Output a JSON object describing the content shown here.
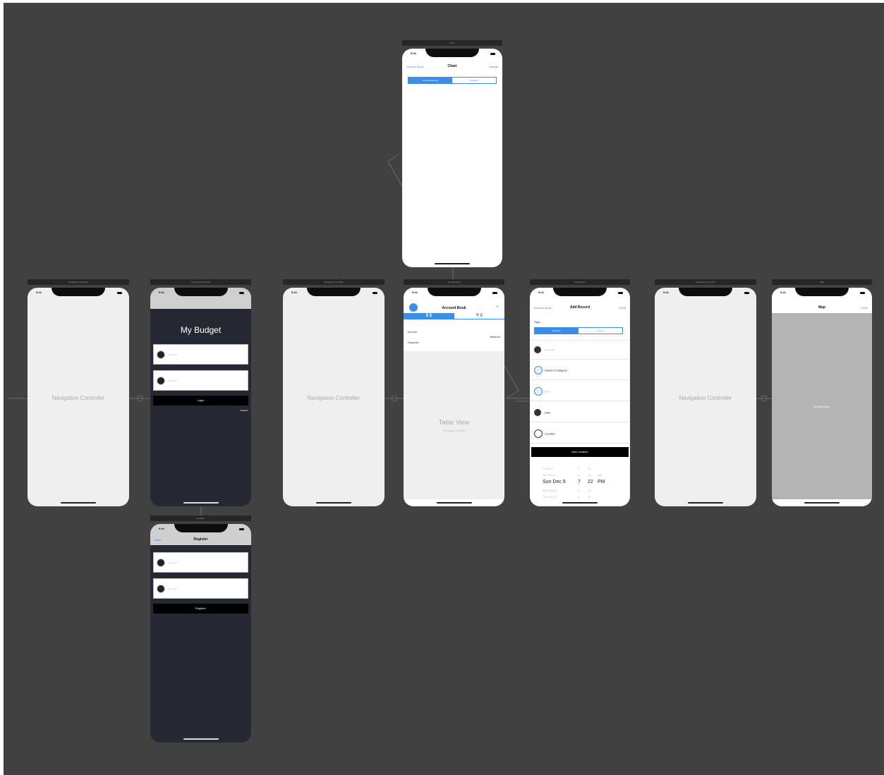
{
  "scene_headers": {
    "chart": "Chart",
    "nav1": "Navigation Controller",
    "login": "Login View Controller",
    "nav2": "Navigation Controller",
    "accountbook": "Account Book",
    "addrecord": "Add Record",
    "nav3": "Navigation Controller",
    "map": "Map",
    "register": "Register"
  },
  "status_time": "9:41",
  "navigation_controller": {
    "label": "Navigation Controller"
  },
  "chart_screen": {
    "back_label": "Account Book",
    "title": "Chart",
    "right_label": "change",
    "segments": [
      "Income/Expense",
      "Category"
    ]
  },
  "login": {
    "title": "My Budget",
    "username_placeholder": "Username",
    "password_placeholder": "Password",
    "login_label": "Login",
    "register_label": "Register"
  },
  "register_screen": {
    "back_label": "Back",
    "title": "Register",
    "username_placeholder": "Username",
    "password_placeholder": "Password",
    "register_label": "Register"
  },
  "account_book": {
    "title": "Account Book",
    "add_icon": "+",
    "tabs": [
      "$ $",
      "₹ $"
    ],
    "income_label": "Income",
    "expense_label": "Expense",
    "balance_label": "Balance",
    "table_title": "Table View",
    "table_subtitle": "Prototype Content"
  },
  "add_record": {
    "back_label": "Account Book",
    "title": "Add Record",
    "done_label": "Done",
    "type_label": "Type",
    "type_segments": [
      "Expense",
      "Income"
    ],
    "amount_placeholder": "Amount",
    "category_label": "Select a Category",
    "note_placeholder": "Note",
    "date_label": "Date",
    "location_label": "Location",
    "add_location_label": "Add Location",
    "picker_rows": [
      {
        "day": "Fri Dec 7",
        "hour": "5",
        "minute": "20",
        "ampm": ""
      },
      {
        "day": "Sat Dec 8",
        "hour": "6",
        "minute": "21",
        "ampm": "AM"
      },
      {
        "day": "Sun Dec 9",
        "hour": "7",
        "minute": "22",
        "ampm": "PM"
      },
      {
        "day": "Mon Dec 10",
        "hour": "8",
        "minute": "23",
        "ampm": ""
      },
      {
        "day": "Tue Dec 11",
        "hour": "9",
        "minute": "24",
        "ampm": ""
      }
    ]
  },
  "map_screen": {
    "title": "Map",
    "done_label": "Done",
    "map_label": "MKMapView"
  },
  "colors": {
    "canvas": "#414141",
    "accent": "#3a8ee8",
    "dark_scene": "#262833"
  }
}
